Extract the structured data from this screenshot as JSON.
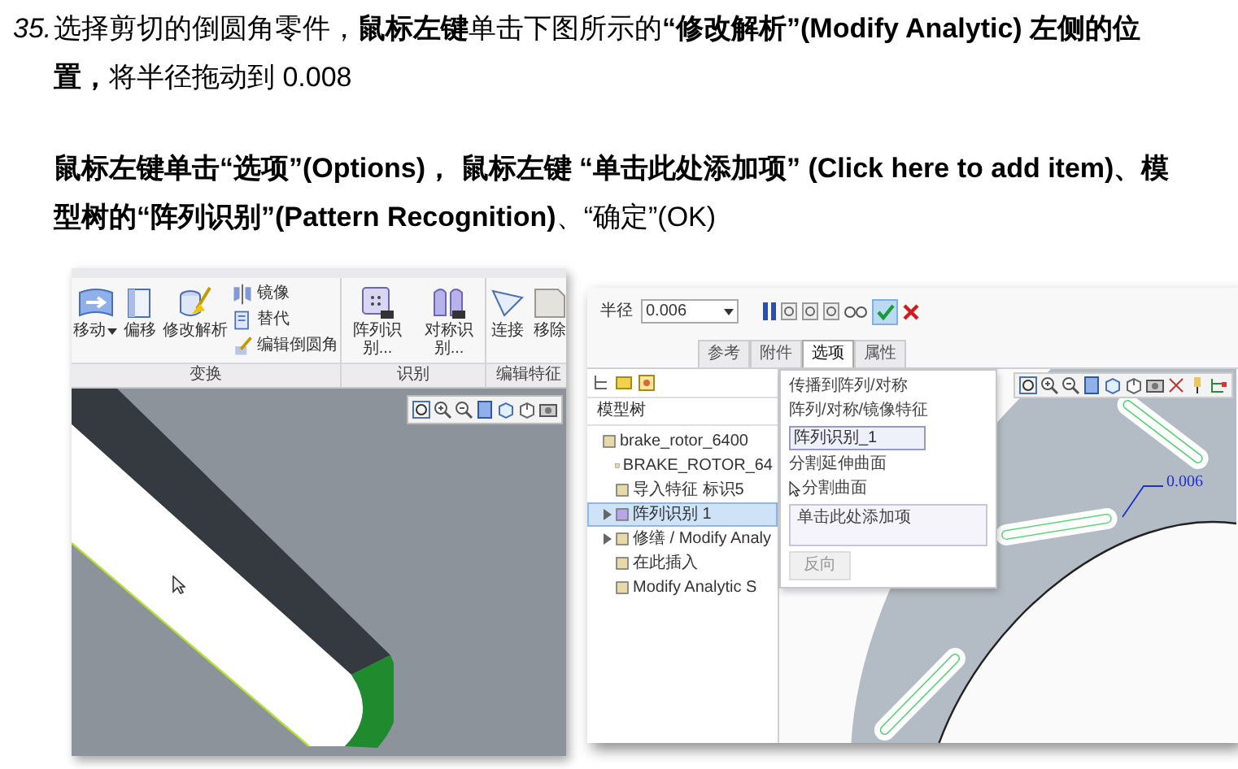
{
  "instructions": [
    {
      "kind": "numbered",
      "number": "35.",
      "text": "选择剪切的倒圆角零件，**鼠标左键**单击下图所示的**“修改解析”(Modify Analytic) 左侧的位置，**将半径拖动到 0.008"
    },
    {
      "kind": "plain",
      "text": "**鼠标左键单击“选项”(Options)， 鼠标左键 “单击此处添加项” (Click here to add item)、模型树的“阵列识别”(Pattern Recognition)**、“确定”(OK)"
    }
  ],
  "left_screenshot": {
    "ribbon_groups": [
      {
        "label": "变换",
        "tools": [
          {
            "kind": "large",
            "label": "移动",
            "dropdown": true
          },
          {
            "kind": "large",
            "label": "偏移",
            "dropdown": false
          },
          {
            "kind": "large",
            "label": "修改解析",
            "dropdown": false
          },
          {
            "kind": "small",
            "label": "镜像"
          },
          {
            "kind": "small",
            "label": "替代"
          },
          {
            "kind": "small",
            "label": "编辑倒圆角"
          }
        ]
      },
      {
        "label": "识别",
        "tools": [
          {
            "kind": "large",
            "label": "阵列识别...",
            "dropdown": false
          },
          {
            "kind": "large",
            "label": "对称识别...",
            "dropdown": false
          }
        ]
      },
      {
        "label": "编辑特征",
        "tools": [
          {
            "kind": "large",
            "label": "连接",
            "dropdown": false
          },
          {
            "kind": "large",
            "label": "移除",
            "dropdown": false
          }
        ]
      }
    ]
  },
  "right_screenshot": {
    "radius": {
      "label": "半径",
      "value": "0.006"
    },
    "tabs": [
      {
        "label": "参考",
        "selected": false
      },
      {
        "label": "附件",
        "selected": false
      },
      {
        "label": "选项",
        "selected": true
      },
      {
        "label": "属性",
        "selected": false
      }
    ],
    "model_tree": {
      "title": "模型树",
      "items": [
        {
          "label": "brake_rotor_6400",
          "expandable": false,
          "selected": false,
          "children": [
            {
              "label": "BRAKE_ROTOR_64",
              "expandable": false,
              "selected": false
            },
            {
              "label": "导入特征 标识5",
              "expandable": false,
              "selected": false
            },
            {
              "label": "阵列识别 1",
              "expandable": true,
              "selected": true
            },
            {
              "label": "修缮 / Modify Analy",
              "expandable": true,
              "selected": false
            },
            {
              "label": "在此插入",
              "expandable": false,
              "selected": false
            },
            {
              "label": "Modify Analytic S",
              "expandable": false,
              "selected": false
            }
          ]
        }
      ]
    },
    "options_panel": {
      "propagate_heading": "传播到阵列/对称",
      "feature_label": "阵列/对称/镜像特征",
      "feature_value": "阵列识别_1",
      "split_heading": "分割延伸曲面",
      "split_label": "分割曲面",
      "collector_prompt": "单击此处添加项",
      "flip_button": {
        "label": "反向",
        "disabled": true
      }
    },
    "dimension": "0.006"
  }
}
